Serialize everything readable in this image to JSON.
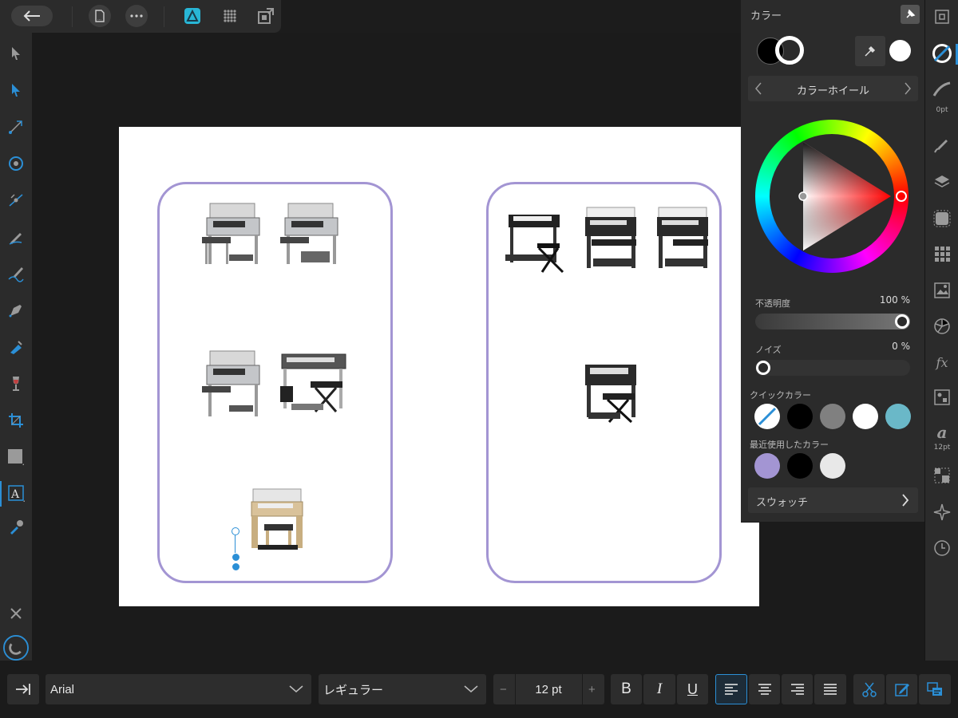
{
  "top_toolbar": {
    "icons": [
      "back-arrow-icon",
      "document-icon",
      "more-icon",
      "designer-persona-icon",
      "pixel-persona-icon",
      "export-persona-icon"
    ]
  },
  "tools": [
    "move-tool-icon",
    "node-tool-icon",
    "point-transform-icon",
    "corner-tool-icon",
    "contour-tool-icon",
    "pencil-icon",
    "vector-brush-icon",
    "pen-tool-icon",
    "fill-tool-icon",
    "transparency-tool-icon",
    "crop-icon",
    "rectangle-icon",
    "artistic-text-icon",
    "color-picker-icon"
  ],
  "color_panel": {
    "title": "カラー",
    "mode_label": "カラーホイール",
    "fill_color": "#000000",
    "stroke_color": "#ffffff",
    "opacity_label": "不透明度",
    "opacity_value": "100 %",
    "opacity": 1.0,
    "noise_label": "ノイズ",
    "noise_value": "0 %",
    "noise": 0.0,
    "quick_colors_label": "クイックカラー",
    "quick_colors": [
      "none",
      "#000000",
      "#808080",
      "#ffffff",
      "#6ab8c8"
    ],
    "recent_colors_label": "最近使用したカラー",
    "recent_colors": [
      "#a395d3",
      "#000000",
      "#e8e8e8"
    ],
    "swatches_label": "スウォッチ"
  },
  "studio_strip": {
    "stroke_label": "0pt",
    "text_size_label": "12pt",
    "fx_label": "fx",
    "char_label": "a",
    "icons": [
      "navigator-icon",
      "color-icon",
      "stroke-icon",
      "brushes-icon",
      "layers-icon",
      "constraints-icon",
      "transform-grid-icon",
      "assets-icon",
      "appearance-icon",
      "effects-icon",
      "styles-icon",
      "text-styles-icon",
      "transform-icon",
      "snapping-icon",
      "history-icon"
    ]
  },
  "bottom_bar": {
    "font_family": "Arial",
    "font_style": "レギュラー",
    "font_size": "12 pt",
    "minus": "−",
    "plus": "+",
    "bold": "B",
    "italic": "I",
    "underline": "U"
  },
  "colors": {
    "accent": "#2b8fd6",
    "frame": "#a395d3"
  }
}
